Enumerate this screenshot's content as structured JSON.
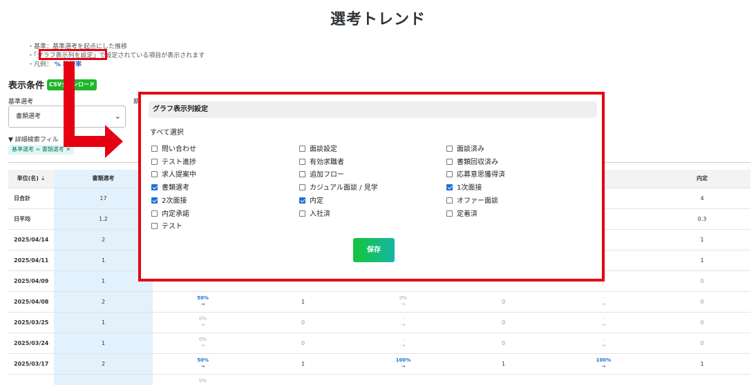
{
  "page": {
    "title": "選考トレンド",
    "notes": [
      "・基準：基準選考を起点にした推移",
      "・「グラフ表示列を設定」で設定されている項目が表示されます",
      "・凡例：",
      "% 移行率"
    ]
  },
  "conditions": {
    "title": "表示条件",
    "csv_button": "CSVダウンロード",
    "base_label": "基準選考",
    "base_value": "書類選考",
    "period_label": "期",
    "filter_toggle": "▼ 詳細検索フィル",
    "chip": "基準選考 = 書類選考 ✕"
  },
  "table": {
    "headers": [
      "単位(名) ⇣",
      "書類選考",
      "",
      "",
      "",
      "",
      "",
      "内定"
    ],
    "rows": [
      {
        "date": "日合計",
        "c1": "17",
        "c7": "4"
      },
      {
        "date": "日平均",
        "c1": "1.2",
        "c7": "0.3"
      },
      {
        "date": "2025/04/14",
        "c1": "2",
        "c7": "1"
      },
      {
        "date": "2025/04/11",
        "c1": "1",
        "c7": "1"
      },
      {
        "date": "2025/04/09",
        "c1": "1",
        "c7": "0"
      },
      {
        "date": "2025/04/08",
        "c1": "2",
        "r2": "50%",
        "c3": "1",
        "r4": "0%",
        "c5": "0",
        "r6": "-",
        "c7": "0"
      },
      {
        "date": "2025/03/25",
        "c1": "1",
        "r2": "0%",
        "c3": "0",
        "r4": "-",
        "c5": "0",
        "r6": "-",
        "c7": "0"
      },
      {
        "date": "2025/03/24",
        "c1": "1",
        "r2": "0%",
        "c3": "0",
        "r4": "-",
        "c5": "0",
        "r6": "-",
        "c7": "0"
      },
      {
        "date": "2025/03/17",
        "c1": "2",
        "r2": "50%",
        "c3": "1",
        "r4": "100%",
        "c5": "1",
        "r6": "100%",
        "c7": "1"
      },
      {
        "date": "",
        "c1": "",
        "r2": "0%",
        "c3": "",
        "r4": "",
        "c5": "",
        "r6": "",
        "c7": ""
      }
    ]
  },
  "modal": {
    "title": "グラフ表示列設定",
    "select_all": "すべて選択",
    "options": [
      {
        "label": "問い合わせ",
        "checked": false
      },
      {
        "label": "面談設定",
        "checked": false
      },
      {
        "label": "面談済み",
        "checked": false
      },
      {
        "label": "テスト進捗",
        "checked": false
      },
      {
        "label": "有効求職者",
        "checked": false
      },
      {
        "label": "書類回収済み",
        "checked": false
      },
      {
        "label": "求人提案中",
        "checked": false
      },
      {
        "label": "追加フロー",
        "checked": false
      },
      {
        "label": "応募意思獲得済",
        "checked": false
      },
      {
        "label": "書類選考",
        "checked": true
      },
      {
        "label": "カジュアル面談 / 見学",
        "checked": false
      },
      {
        "label": "1次面接",
        "checked": true
      },
      {
        "label": "2次面接",
        "checked": true
      },
      {
        "label": "内定",
        "checked": true
      },
      {
        "label": "オファー面談",
        "checked": false
      },
      {
        "label": "内定承諾",
        "checked": false
      },
      {
        "label": "入社済",
        "checked": false
      },
      {
        "label": "定着済",
        "checked": false
      },
      {
        "label": "テスト",
        "checked": false
      }
    ],
    "save_label": "保存"
  },
  "colors": {
    "accent_red": "#e60012",
    "check_blue": "#1f6fd1",
    "save_start": "#13c63a",
    "save_end": "#16b6a6",
    "selected_col": "#e3f1fd"
  }
}
